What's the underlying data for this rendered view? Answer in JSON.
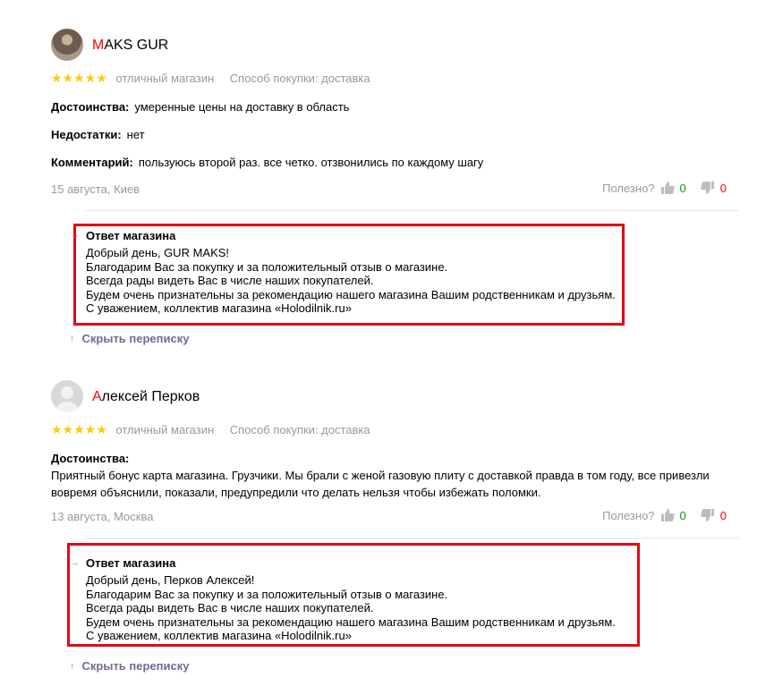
{
  "reviews": [
    {
      "author_first": "M",
      "author_rest": "AKS GUR",
      "stars": "★★★★★",
      "grade": "отличный магазин",
      "purchase": "Способ покупки: доставка",
      "pros_label": "Достоинства:",
      "pros": "умеренные цены на доставку в область",
      "cons_label": "Недостатки:",
      "cons": "нет",
      "comment_label": "Комментарий:",
      "comment": "пользуюсь второй раз. все четко. отзвонились по каждому шагу",
      "date": "15 августа, Киев",
      "useful_label": "Полезно?",
      "likes": "0",
      "dislikes": "0",
      "reply_title": "Ответ магазина",
      "reply_lines": [
        "Добрый день, GUR MAKS!",
        "Благодарим Вас за покупку и за положительный отзыв о магазине.",
        "Всегда рады видеть Вас в числе наших покупателей.",
        "Будем очень признательны за рекомендацию нашего магазина Вашим родственникам и друзьям.",
        "С уважением, коллектив магазина «Holodilnik.ru»"
      ],
      "hide_label": "Скрыть переписку"
    },
    {
      "author_first": "А",
      "author_rest": "лексей Перков",
      "stars": "★★★★★",
      "grade": "отличный магазин",
      "purchase": "Способ покупки: доставка",
      "pros_label": "Достоинства:",
      "pros_lines": [
        "Приятный бонус карта магазина. Грузчики. Мы брали с женой газовую плиту с доставкой правда в том году, все привезли",
        "вовремя объяснили, показали, предупредили что делать нельзя чтобы избежать поломки."
      ],
      "date": "13 августа, Москва",
      "useful_label": "Полезно?",
      "likes": "0",
      "dislikes": "0",
      "reply_title": "Ответ магазина",
      "reply_lines": [
        "Добрый день, Перков Алексей!",
        "Благодарим Вас за покупку и за положительный отзыв о магазине.",
        "Всегда рады видеть Вас в числе наших покупателей.",
        "Будем очень признательны за рекомендацию нашего магазина Вашим родственникам и друзьям.",
        "С уважением, коллектив магазина «Holodilnik.ru»"
      ],
      "hide_label": "Скрыть переписку"
    }
  ],
  "icons": {
    "like": "thumb-up-icon",
    "dislike": "thumb-down-icon",
    "reply_arrow": "arrow-right-icon",
    "hide_arrow": "arrow-up-icon"
  },
  "colors": {
    "highlight": "#e30613",
    "stars": "#ffcc00",
    "positive": "#009900",
    "negative": "#ff0000",
    "link": "#6c6c9c",
    "muted": "#999999"
  }
}
